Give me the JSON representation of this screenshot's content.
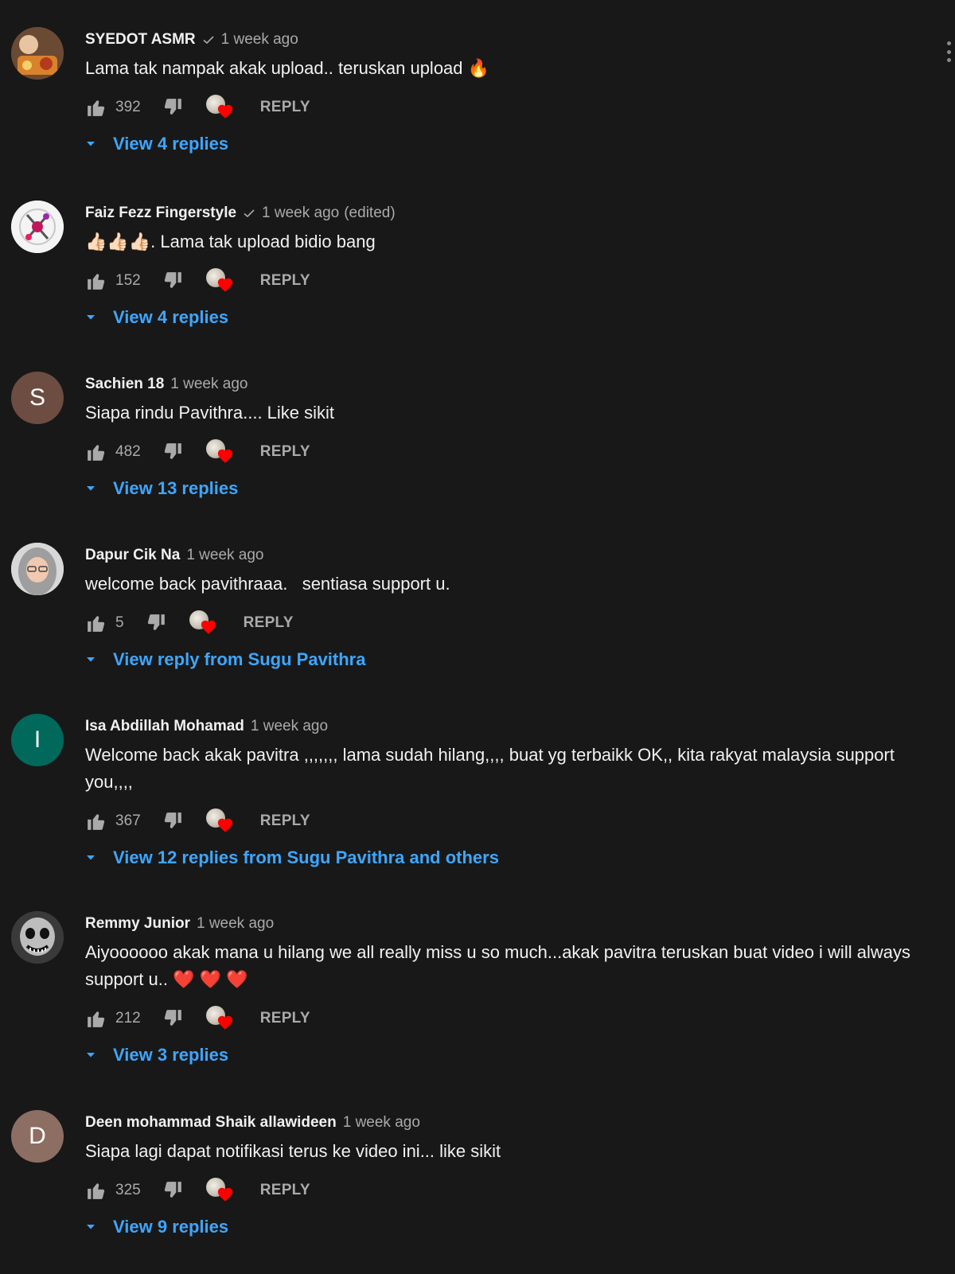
{
  "comments": [
    {
      "author": "SYEDOT ASMR",
      "verified": true,
      "time": "1 week ago",
      "edited": "",
      "text": "Lama tak nampak akak upload.. teruskan upload 🔥",
      "likes": "392",
      "reply_label": "REPLY",
      "view_replies": "View 4 replies",
      "avatar": {
        "type": "photo",
        "icon": "food-photo-avatar"
      }
    },
    {
      "author": "Faiz Fezz Fingerstyle",
      "verified": true,
      "time": "1 week ago",
      "edited": "(edited)",
      "text": "👍🏻👍🏻👍🏻. Lama tak upload bidio bang",
      "likes": "152",
      "reply_label": "REPLY",
      "view_replies": "View 4 replies",
      "avatar": {
        "type": "photo",
        "icon": "guitar-logo-avatar"
      }
    },
    {
      "author": "Sachien 18",
      "verified": false,
      "time": "1 week ago",
      "edited": "",
      "text": "Siapa rindu Pavithra.... Like sikit",
      "likes": "482",
      "reply_label": "REPLY",
      "view_replies": "View 13 replies",
      "avatar": {
        "type": "letter",
        "letter": "S",
        "color": "#6d4c41"
      }
    },
    {
      "author": "Dapur Cik Na",
      "verified": false,
      "time": "1 week ago",
      "edited": "",
      "text": "welcome back pavithraaa.   sentiasa support u.",
      "likes": "5",
      "reply_label": "REPLY",
      "view_replies": "View reply from Sugu Pavithra",
      "avatar": {
        "type": "photo",
        "icon": "person-hijab-avatar"
      }
    },
    {
      "author": "Isa Abdillah Mohamad",
      "verified": false,
      "time": "1 week ago",
      "edited": "",
      "text": "Welcome back akak pavitra ,,,,,,, lama sudah hilang,,,, buat yg terbaikk OK,, kita rakyat malaysia support you,,,,",
      "likes": "367",
      "reply_label": "REPLY",
      "view_replies": "View 12 replies from Sugu Pavithra and others",
      "avatar": {
        "type": "letter",
        "letter": "I",
        "color": "#00695c"
      }
    },
    {
      "author": "Remmy Junior",
      "verified": false,
      "time": "1 week ago",
      "edited": "",
      "text": "Aiyoooooo akak mana u hilang we all really miss u so much...akak pavitra teruskan buat video i will always support u.. ❤️ ❤️ ❤️",
      "likes": "212",
      "reply_label": "REPLY",
      "view_replies": "View 3 replies",
      "avatar": {
        "type": "photo",
        "icon": "skull-mask-avatar"
      }
    },
    {
      "author": "Deen mohammad Shaik allawideen",
      "verified": false,
      "time": "1 week ago",
      "edited": "",
      "text": "Siapa lagi dapat notifikasi terus ke video ini... like sikit",
      "likes": "325",
      "reply_label": "REPLY",
      "view_replies": "View 9 replies",
      "avatar": {
        "type": "letter",
        "letter": "D",
        "color": "#8d6e63"
      }
    }
  ],
  "colors": {
    "background": "#181818",
    "text": "#f1f1f1",
    "secondary_text": "#aaaaaa",
    "link": "#3ea6ff",
    "heart": "#ff0000"
  },
  "icons": {
    "like": "thumb-up-icon",
    "dislike": "thumb-down-icon",
    "heart": "creator-heart-icon",
    "caret": "caret-down-icon",
    "menu": "more-vert-icon",
    "verified": "check-icon"
  }
}
